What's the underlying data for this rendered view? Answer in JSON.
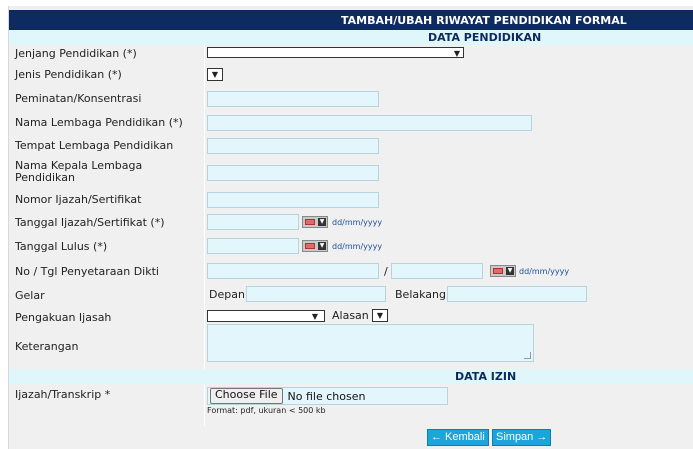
{
  "header": {
    "title": "TAMBAH/UBAH RIWAYAT PENDIDIKAN FORMAL"
  },
  "sections": {
    "pendidikan": "DATA PENDIDIKAN",
    "izin": "DATA IZIN"
  },
  "fields": {
    "jenjang": {
      "label": "Jenjang Pendidikan (*)",
      "value": ""
    },
    "jenis": {
      "label": "Jenis Pendidikan (*)",
      "value": ""
    },
    "peminatan": {
      "label": "Peminatan/Konsentrasi",
      "value": ""
    },
    "lembaga": {
      "label": "Nama Lembaga Pendidikan (*)",
      "value": ""
    },
    "tempat": {
      "label": "Tempat Lembaga Pendidikan",
      "value": ""
    },
    "kepala": {
      "label": "Nama Kepala Lembaga Pendidikan",
      "value": ""
    },
    "nomor_ijazah": {
      "label": "Nomor Ijazah/Sertifikat",
      "value": ""
    },
    "tanggal_ijazah": {
      "label": "Tanggal Ijazah/Sertifikat (*)",
      "value": "",
      "format": "dd/mm/yyyy"
    },
    "tanggal_lulus": {
      "label": "Tanggal Lulus (*)",
      "value": "",
      "format": "dd/mm/yyyy"
    },
    "penyetaraan": {
      "label": "No / Tgl Penyetaraan Dikti",
      "separator": "/",
      "value_no": "",
      "value_tgl": "",
      "format": "dd/mm/yyyy"
    },
    "gelar": {
      "label": "Gelar",
      "depan_label": "Depan",
      "belakang_label": "Belakang",
      "depan_value": "",
      "belakang_value": ""
    },
    "pengakuan": {
      "label": "Pengakuan Ijasah",
      "value": "",
      "alasan_label": "Alasan",
      "alasan_value": ""
    },
    "keterangan": {
      "label": "Keterangan",
      "value": ""
    },
    "ijazah": {
      "label": "Ijazah/Transkrip *",
      "button": "Choose File",
      "status": "No file chosen",
      "note": "Format: pdf, ukuran < 500 kb"
    }
  },
  "buttons": {
    "kembali": "← Kembali",
    "simpan": "Simpan →"
  },
  "colors": {
    "header_bg": "#0d2b5e",
    "section_bg": "#dff6fb",
    "input_bg": "#e3f6fb",
    "button_bg": "#1aa6d9"
  },
  "icons": [
    "calendar-icon",
    "dropdown-arrow-icon"
  ]
}
